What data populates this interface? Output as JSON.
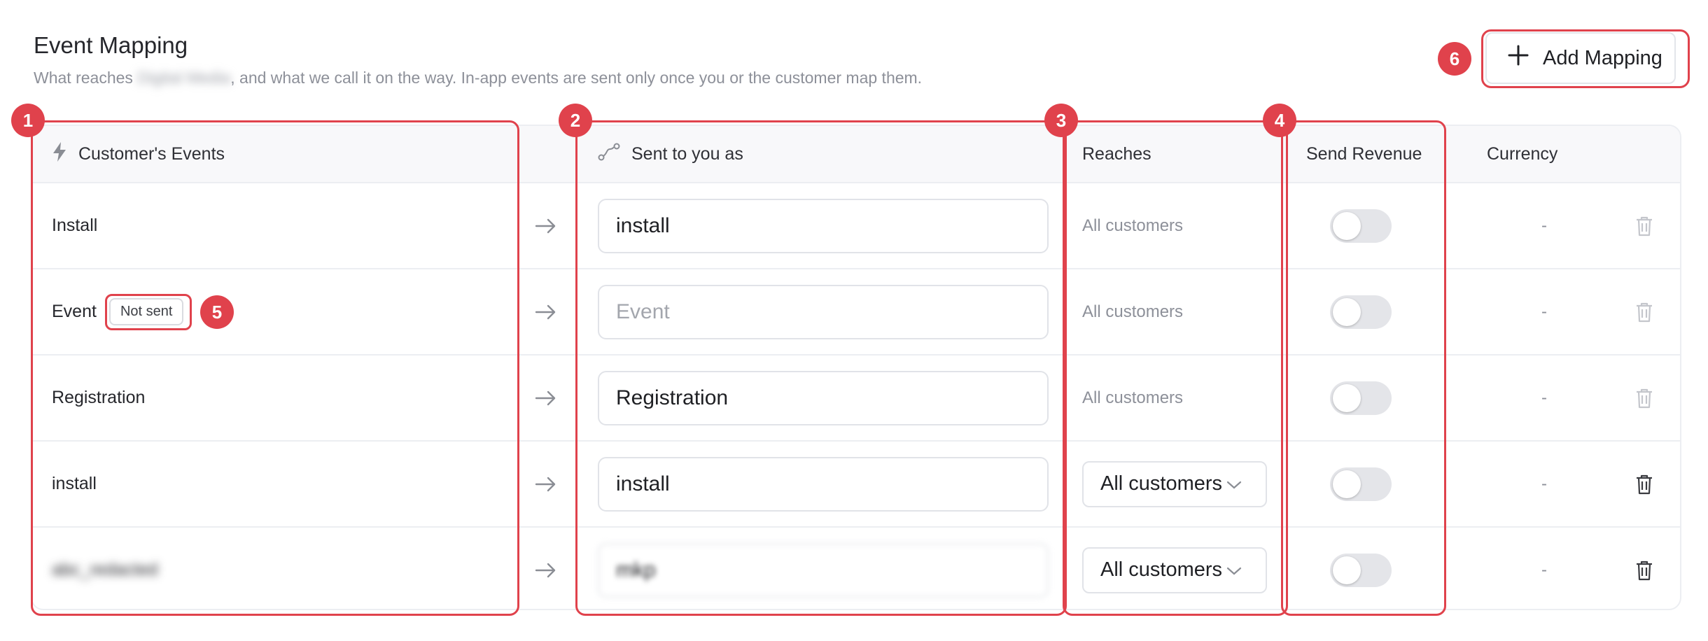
{
  "header": {
    "title": "Event Mapping",
    "subtitle_before": "What reaches",
    "subtitle_redacted": "Digital Media",
    "subtitle_after": ", and what we call it on the way. In-app events are sent only once you or the customer map them.",
    "add_button_label": "Add Mapping"
  },
  "columns": {
    "customer_events": "Customer's Events",
    "sent_as": "Sent to you as",
    "reaches": "Reaches",
    "send_revenue": "Send Revenue",
    "currency": "Currency"
  },
  "rows": [
    {
      "event": "Install",
      "badge": "",
      "value": "install",
      "placeholder": "",
      "reaches": "All customers",
      "reaches_type": "text",
      "revenue": false,
      "currency": "-",
      "delete_enabled": false
    },
    {
      "event": "Event",
      "badge": "Not sent",
      "value": "",
      "placeholder": "Event",
      "reaches": "All customers",
      "reaches_type": "text",
      "revenue": false,
      "currency": "-",
      "delete_enabled": false
    },
    {
      "event": "Registration",
      "badge": "",
      "value": "Registration",
      "placeholder": "",
      "reaches": "All customers",
      "reaches_type": "text",
      "revenue": false,
      "currency": "-",
      "delete_enabled": false
    },
    {
      "event": "install",
      "badge": "",
      "value": "install",
      "placeholder": "",
      "reaches": "All customers",
      "reaches_type": "select",
      "revenue": false,
      "currency": "-",
      "delete_enabled": true
    },
    {
      "event": "abc_redacted",
      "badge": "",
      "value": "mkp",
      "placeholder": "",
      "reaches": "All customers",
      "reaches_type": "select",
      "revenue": false,
      "currency": "-",
      "delete_enabled": true,
      "redacted": true
    }
  ],
  "annotations": [
    "1",
    "2",
    "3",
    "4",
    "5",
    "6"
  ],
  "colors": {
    "accent": "#e0424c",
    "border": "#eceef2",
    "muted": "#8d9099"
  }
}
